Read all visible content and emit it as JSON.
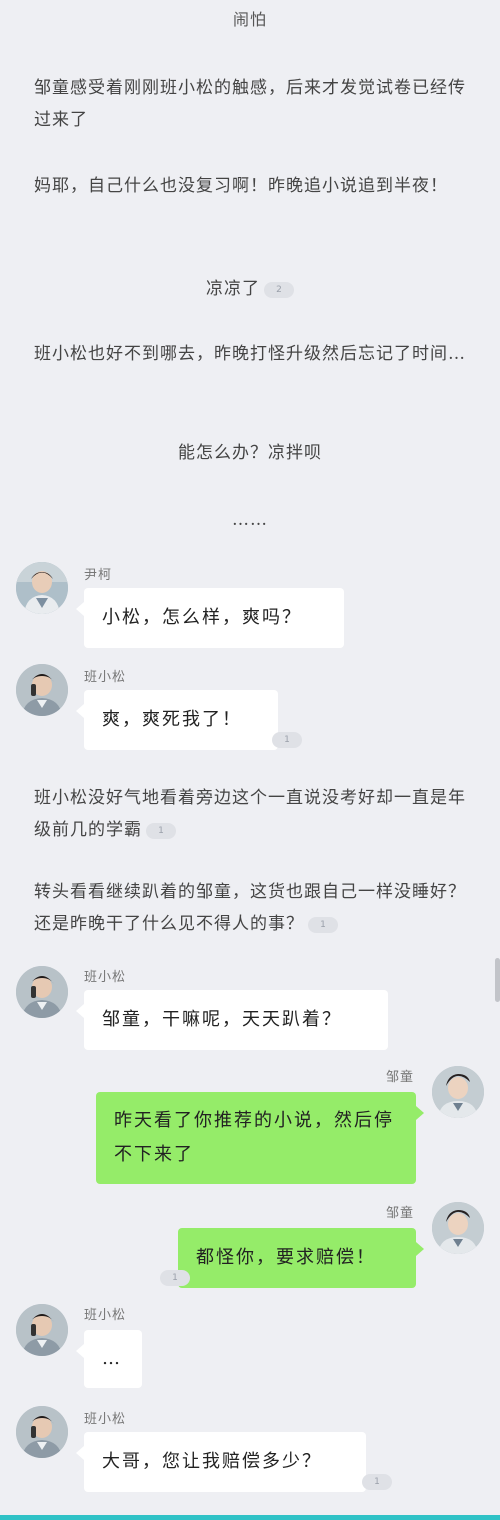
{
  "chapter_title": "闹怕",
  "narration": [
    {
      "text": "邹童感受着刚刚班小松的触感，后来才发觉试卷已经传过来了"
    },
    {
      "text": "妈耶，自己什么也没复习啊！昨晚追小说追到半夜！"
    },
    {
      "text": "凉凉了",
      "badge": "2"
    },
    {
      "text": "班小松也好不到哪去，昨晚打怪升级然后忘记了时间…"
    },
    {
      "text": "能怎么办？凉拌呗"
    },
    {
      "text": "……"
    },
    {
      "text": "班小松没好气地看着旁边这个一直说没考好却一直是年级前几的学霸",
      "badge": "1"
    },
    {
      "text": "转头看看继续趴着的邹童，这货也跟自己一样没睡好？还是昨晚干了什么见不得人的事？",
      "badge": "1"
    }
  ],
  "messages": [
    {
      "sender": "尹柯",
      "text": "小松，怎么样，爽吗？"
    },
    {
      "sender": "班小松",
      "text": "爽，爽死我了！",
      "badge": "1"
    },
    {
      "sender": "班小松",
      "text": "邹童，干嘛呢，天天趴着？"
    },
    {
      "sender": "邹童",
      "text": "昨天看了你推荐的小说，然后停不下来了"
    },
    {
      "sender": "邹童",
      "text": "都怪你，要求赔偿！",
      "badge": "1"
    },
    {
      "sender": "班小松",
      "text": "…"
    },
    {
      "sender": "班小松",
      "text": "大哥，您让我赔偿多少？",
      "badge": "1"
    }
  ],
  "colors": {
    "background": "#eeeff3",
    "bubble_green": "#95ec69",
    "bubble_white": "#ffffff",
    "bottom_accent": "#2fc2c6"
  }
}
